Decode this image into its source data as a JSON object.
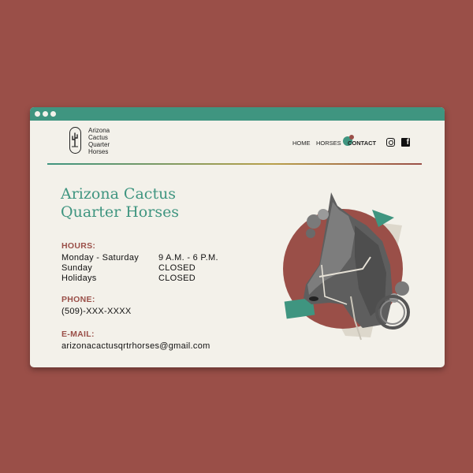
{
  "window": {
    "dots": 3
  },
  "logo": {
    "lines": [
      "Arizona",
      "Cactus",
      "Quarter",
      "Horses"
    ]
  },
  "nav": {
    "home": "HOME",
    "horses": "HORSES",
    "contact": "CONTACT"
  },
  "social": {
    "icons": [
      "instagram-icon",
      "facebook-icon"
    ],
    "facebook_glyph": "f"
  },
  "hero": {
    "title_line1": "Arizona Cactus",
    "title_line2": "Quarter Horses"
  },
  "hours": {
    "label": "HOURS:",
    "rows": [
      {
        "day": "Monday - Saturday",
        "time": "9 A.M. - 6 P.M."
      },
      {
        "day": "Sunday",
        "time": "CLOSED"
      },
      {
        "day": "Holidays",
        "time": "CLOSED"
      }
    ]
  },
  "phone": {
    "label": "PHONE:",
    "value": "(509)-XXX-XXXX"
  },
  "email": {
    "label": "E-MAIL:",
    "value": "arizonacactusqrtrhorses@gmail.com"
  },
  "colors": {
    "page_bg": "#9a4f48",
    "teal": "#3f9580",
    "brick": "#9a4f48",
    "cream": "#f3f1ea"
  }
}
